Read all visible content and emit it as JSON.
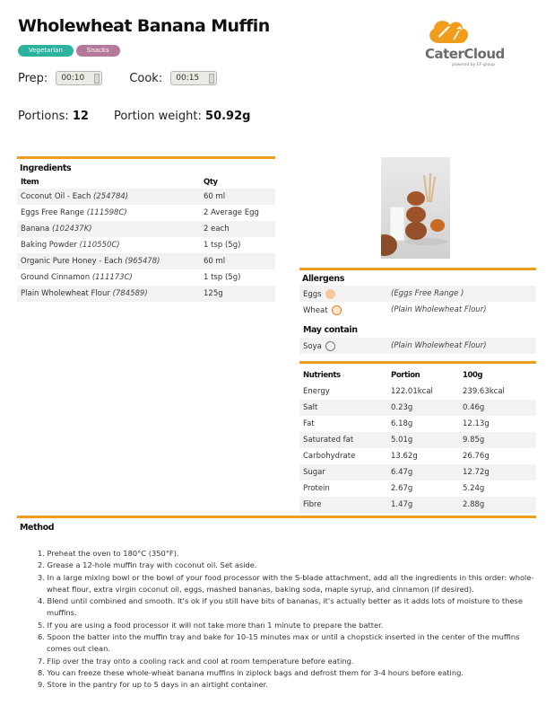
{
  "recipe": {
    "title": "Wholewheat Banana Muffin",
    "tags": [
      "Vegetarian",
      "Snacks"
    ],
    "prep_label": "Prep:",
    "prep_value": "00:10",
    "cook_label": "Cook:",
    "cook_value": "00:15",
    "portions_label": "Portions:",
    "portions_value": "12",
    "portion_weight_label": "Portion weight:",
    "portion_weight_value": "50.92g"
  },
  "logo": {
    "brand": "CaterCloud",
    "tagline": "powered by EF-group",
    "color": "#f09c1d"
  },
  "colors": {
    "accent": "#f09c1d",
    "tag_vegetarian": "#2bb3a0",
    "tag_snacks": "#b57a9a"
  },
  "ingredients": {
    "title": "Ingredients",
    "col_item": "Item",
    "col_qty": "Qty",
    "rows": [
      {
        "name": "Coconut Oil - Each",
        "code": "(254784)",
        "qty": "60 ml"
      },
      {
        "name": "Eggs Free Range",
        "code": "(111598C)",
        "qty": "2 Average Egg"
      },
      {
        "name": "Banana",
        "code": "(102437K)",
        "qty": "2 each"
      },
      {
        "name": "Baking Powder",
        "code": "(110550C)",
        "qty": "1 tsp (5g)"
      },
      {
        "name": "Organic Pure Honey - Each",
        "code": "(965478)",
        "qty": "60 ml"
      },
      {
        "name": "Ground Cinnamon",
        "code": "(111173C)",
        "qty": "1 tsp (5g)"
      },
      {
        "name": "Plain Wholewheat Flour",
        "code": "(784589)",
        "qty": "125g"
      }
    ]
  },
  "allergens": {
    "title": "Allergens",
    "items": [
      {
        "name": "Eggs",
        "icon": "egg-icon",
        "source": "(Eggs Free Range )"
      },
      {
        "name": "Wheat",
        "icon": "wheat-icon",
        "source": "(Plain Wholewheat Flour)"
      }
    ],
    "may_contain_title": "May contain",
    "may_contain": [
      {
        "name": "Soya",
        "icon": "soya-icon",
        "source": "(Plain Wholewheat Flour)"
      }
    ]
  },
  "nutrients": {
    "col_name": "Nutrients",
    "col_portion": "Portion",
    "col_100g": "100g",
    "rows": [
      {
        "name": "Energy",
        "portion": "122.01kcal",
        "per100": "239.63kcal"
      },
      {
        "name": "Salt",
        "portion": "0.23g",
        "per100": "0.46g"
      },
      {
        "name": "Fat",
        "portion": "6.18g",
        "per100": "12.13g"
      },
      {
        "name": "Saturated fat",
        "portion": "5.01g",
        "per100": "9.85g"
      },
      {
        "name": "Carbohydrate",
        "portion": "13.62g",
        "per100": "26.76g"
      },
      {
        "name": "Sugar",
        "portion": "6.47g",
        "per100": "12.72g"
      },
      {
        "name": "Protein",
        "portion": "2.67g",
        "per100": "5.24g"
      },
      {
        "name": "Fibre",
        "portion": "1.47g",
        "per100": "2.88g"
      }
    ]
  },
  "method": {
    "title": "Method",
    "steps": [
      "1. Preheat the oven to 180°C (350°F).",
      "2. Grease a 12-hole muffin tray with coconut oil. Set aside.",
      "3. In a large mixing bowl or the bowl of your food processor with the S-blade attachment, add all the ingredients in this order: whole-wheat flour, extra virgin coconut oil, eggs, mashed bananas, baking soda, maple syrup, and cinnamon (if desired).",
      "4. Blend until combined and smooth. It's ok if you still have bits of bananas, it's actually better as it adds lots of moisture to these muffins.",
      "5. If you are using a food processor it will not take more than 1 minute to prepare the batter.",
      "6. Spoon the batter into the muffin tray and bake for 10-15 minutes max or until a chopstick inserted in the center of the muffins comes out clean.",
      "7. Flip over the tray onto a cooling rack and cool at room temperature before eating.",
      "8. You can freeze these whole-wheat banana muffins in ziplock bags and defrost them for 3-4 hours before eating.",
      "9. Store in the pantry for up to 5 days in an airtight container."
    ]
  }
}
